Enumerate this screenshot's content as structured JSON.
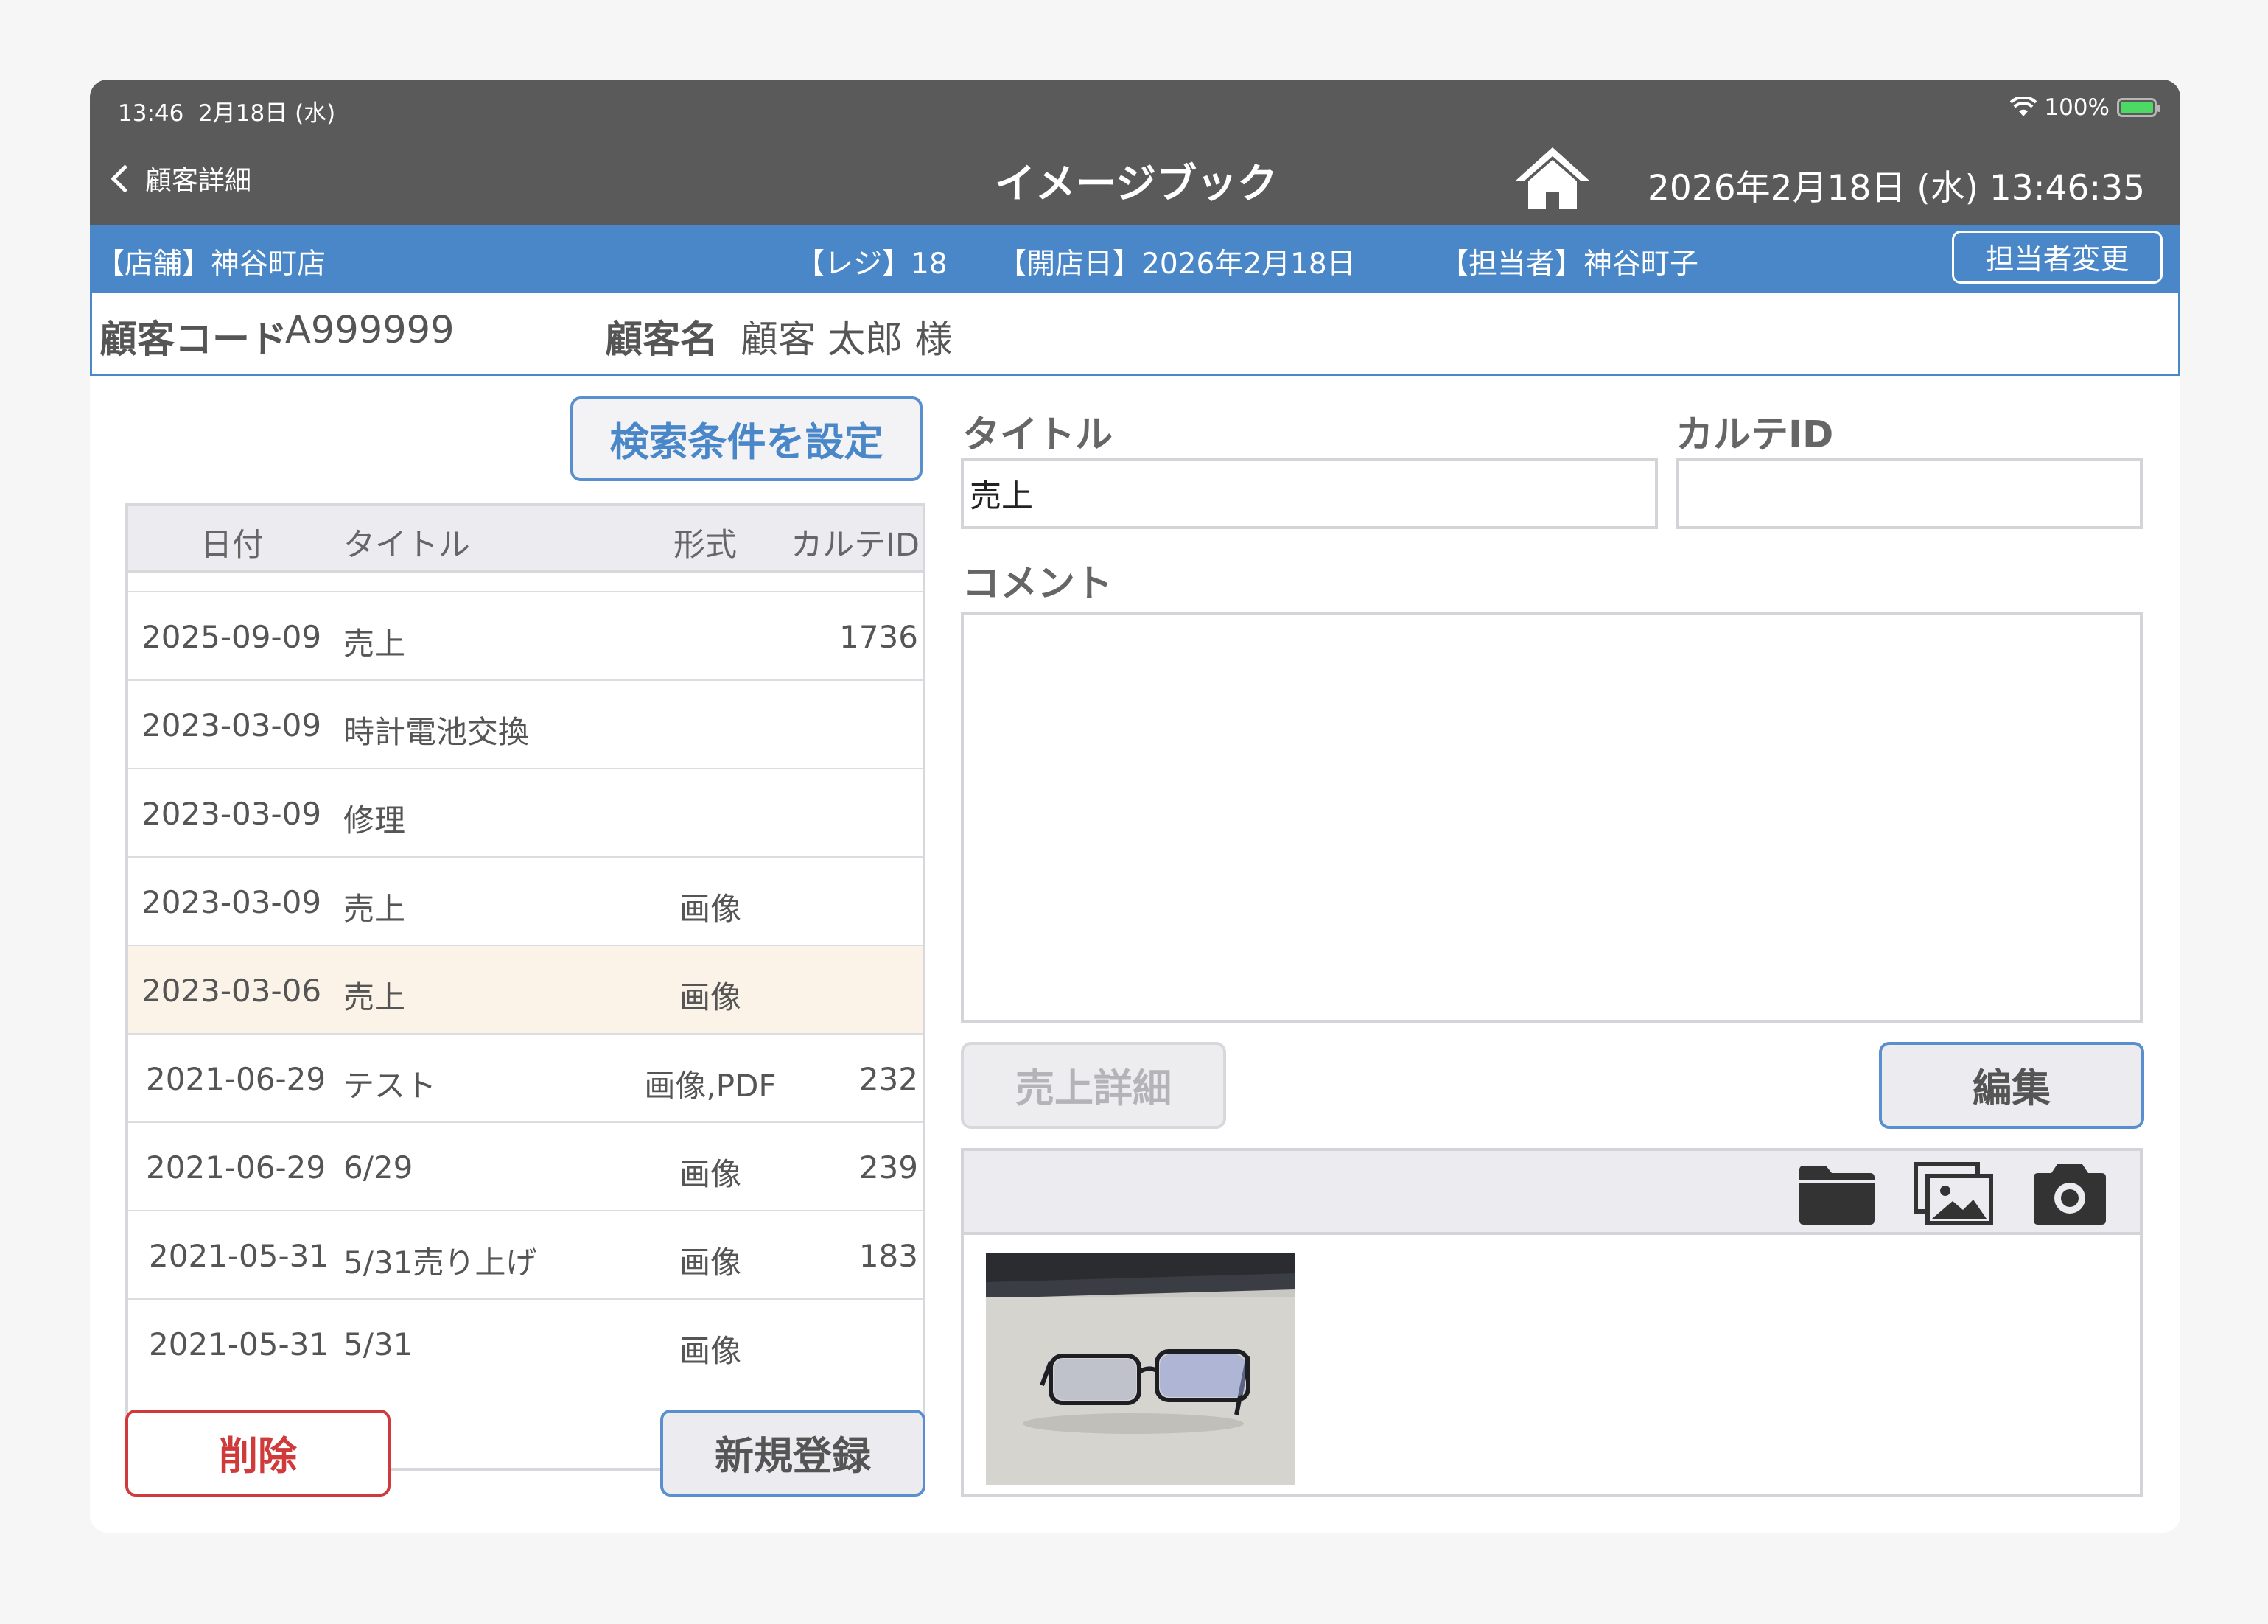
{
  "status": {
    "time": "13:46",
    "date": "2月18日 (水)",
    "battery": "100%",
    "battery_level": 1.0
  },
  "nav": {
    "back_label": "顧客詳細",
    "title": "イメージブック",
    "datetime": "2026年2月18日 (水) 13:46:35"
  },
  "info": {
    "store": "【店舗】神谷町店",
    "register": "【レジ】18",
    "open_date": "【開店日】2026年2月18日",
    "staff": "【担当者】神谷町子",
    "change_staff_label": "担当者変更"
  },
  "customer": {
    "code_label": "顧客コード",
    "code": "A999999",
    "name_label": "顧客名",
    "name": "顧客 太郎 様"
  },
  "left": {
    "search_label": "検索条件を設定",
    "columns": [
      "日付",
      "タイトル",
      "形式",
      "カルテID"
    ],
    "rows": [
      {
        "date": "2025-09-09",
        "title": "売上",
        "format": "",
        "karte_id": "1736"
      },
      {
        "date": "2023-03-09",
        "title": "時計電池交換",
        "format": "",
        "karte_id": ""
      },
      {
        "date": "2023-03-09",
        "title": "修理",
        "format": "",
        "karte_id": ""
      },
      {
        "date": "2023-03-09",
        "title": "売上",
        "format": "画像",
        "karte_id": ""
      },
      {
        "date": "2023-03-06",
        "title": "売上",
        "format": "画像",
        "karte_id": ""
      },
      {
        "date": "2021-06-29",
        "title": "テスト",
        "format": "画像,PDF",
        "karte_id": "232"
      },
      {
        "date": "2021-06-29",
        "title": "6/29",
        "format": "画像",
        "karte_id": "239"
      },
      {
        "date": "2021-05-31",
        "title": "5/31売り上げ",
        "format": "画像",
        "karte_id": "183"
      },
      {
        "date": "2021-05-31",
        "title": "5/31",
        "format": "画像",
        "karte_id": ""
      }
    ],
    "delete_label": "削除",
    "new_label": "新規登録"
  },
  "right": {
    "title_label": "タイトル",
    "title_value": "売上",
    "karte_label": "カルテID",
    "karte_value": "",
    "comment_label": "コメント",
    "comment_value": "",
    "sales_detail_label": "売上詳細",
    "edit_label": "編集",
    "tools": [
      "folder-icon",
      "image-gallery-icon",
      "camera-icon"
    ]
  },
  "colors": {
    "nav_bg": "#5a5a5a",
    "info_bg": "#4a87c9",
    "selected_row": "#fbf3e7",
    "delete": "#d03a3a"
  }
}
